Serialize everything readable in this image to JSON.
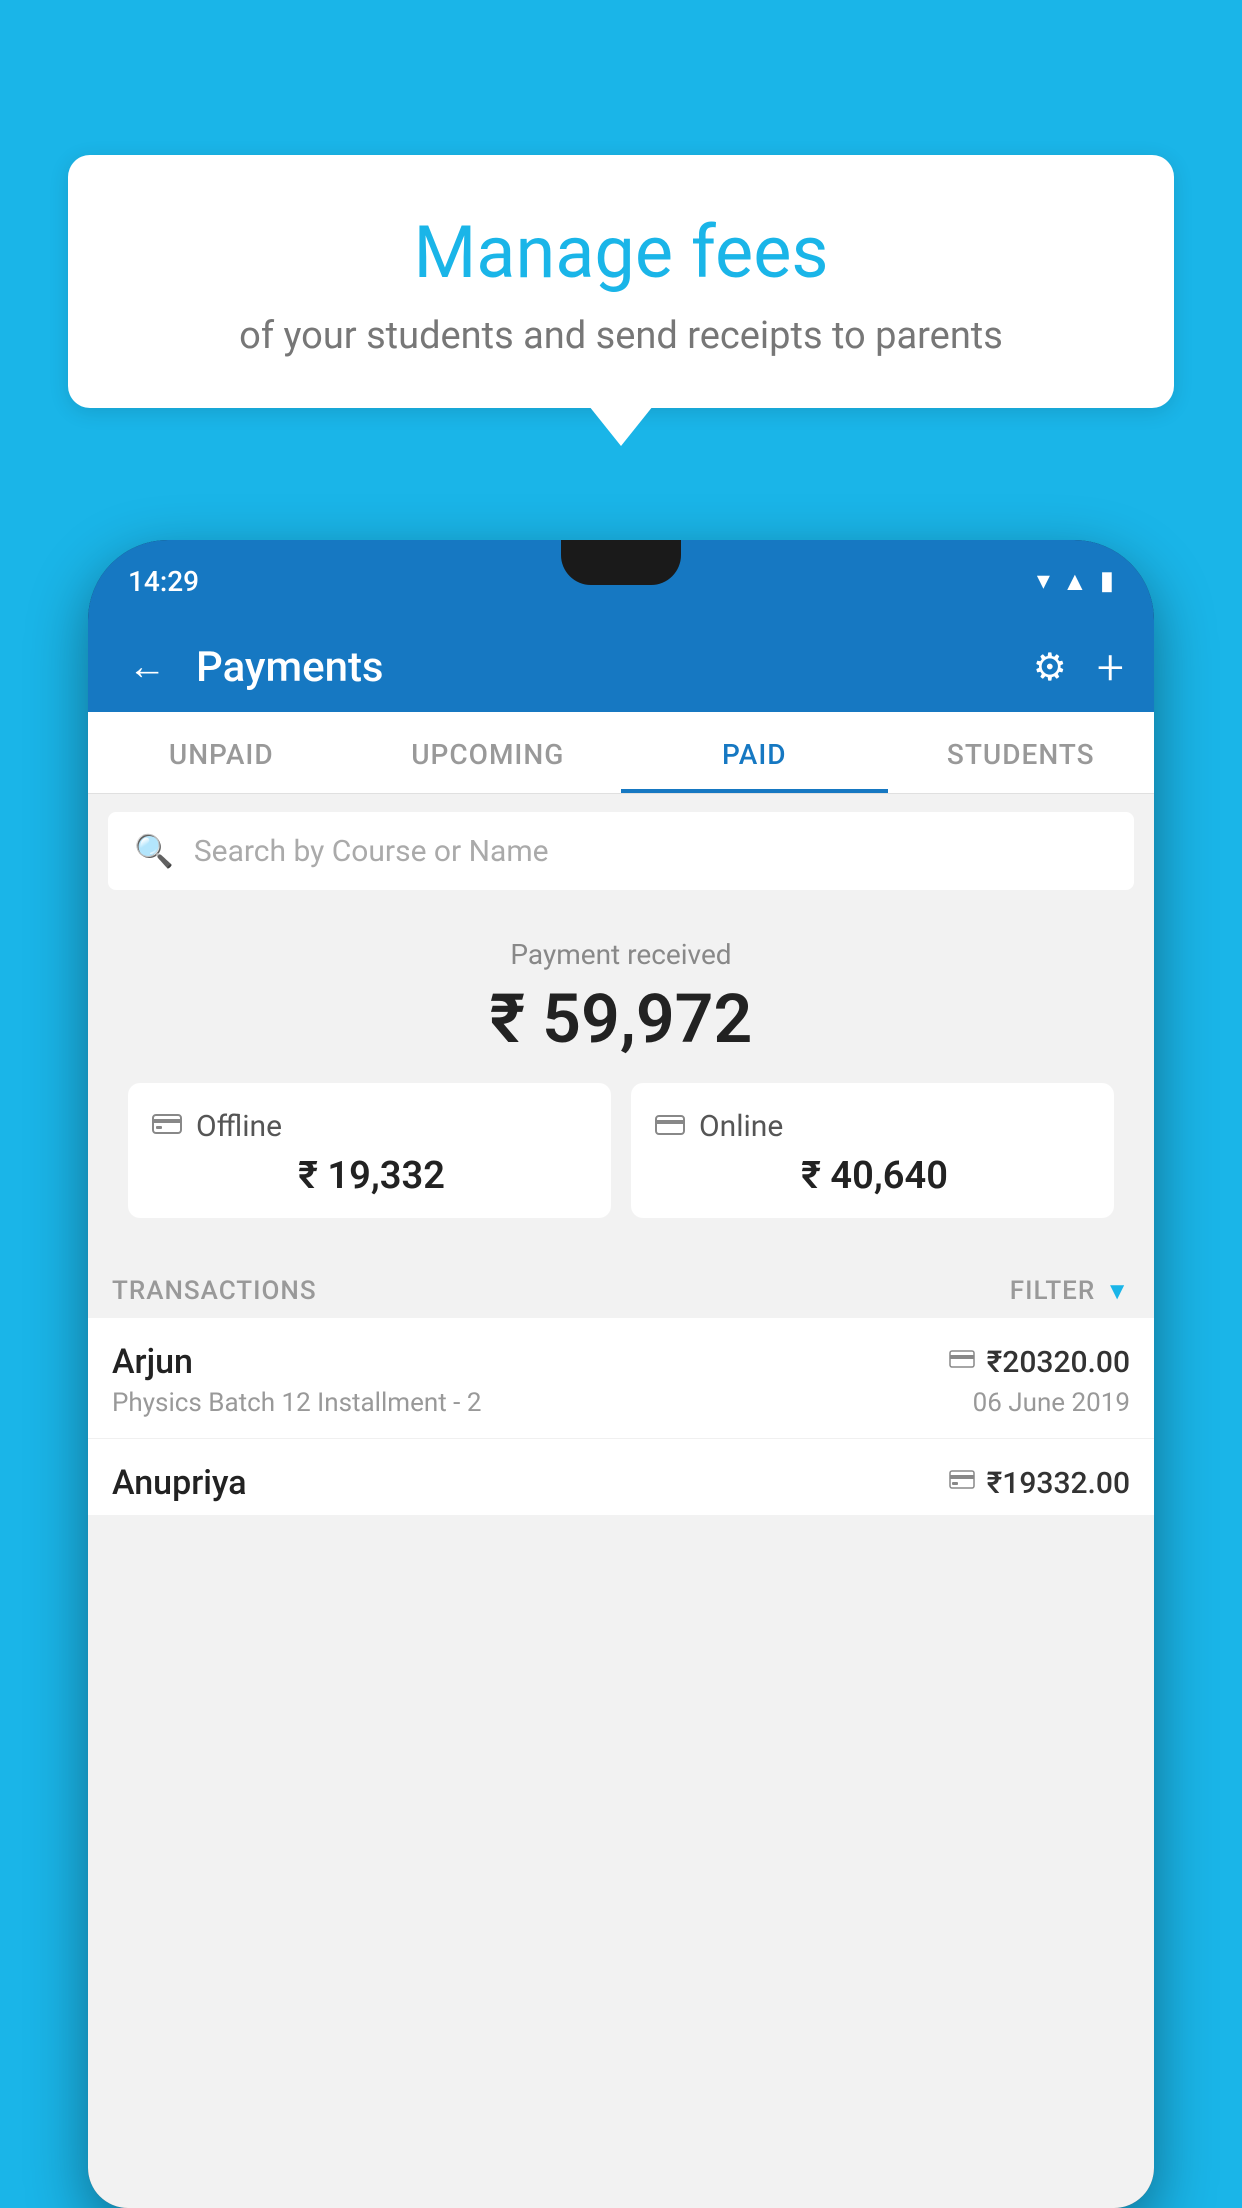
{
  "background_color": "#1ab5e8",
  "tooltip": {
    "title": "Manage fees",
    "subtitle": "of your students and send receipts to parents"
  },
  "phone": {
    "status_time": "14:29",
    "header": {
      "title": "Payments",
      "back_label": "←",
      "settings_icon": "⚙",
      "add_icon": "+"
    },
    "tabs": [
      {
        "label": "UNPAID",
        "active": false
      },
      {
        "label": "UPCOMING",
        "active": false
      },
      {
        "label": "PAID",
        "active": true
      },
      {
        "label": "STUDENTS",
        "active": false
      }
    ],
    "search": {
      "placeholder": "Search by Course or Name"
    },
    "payment_summary": {
      "label": "Payment received",
      "amount": "₹ 59,972",
      "offline": {
        "icon": "💳",
        "label": "Offline",
        "amount": "₹ 19,332"
      },
      "online": {
        "icon": "💳",
        "label": "Online",
        "amount": "₹ 40,640"
      }
    },
    "transactions": {
      "header_label": "TRANSACTIONS",
      "filter_label": "FILTER",
      "items": [
        {
          "name": "Arjun",
          "description": "Physics Batch 12 Installment - 2",
          "amount": "₹20320.00",
          "date": "06 June 2019",
          "payment_type": "online"
        },
        {
          "name": "Anupriya",
          "description": "",
          "amount": "₹19332.00",
          "date": "",
          "payment_type": "offline"
        }
      ]
    }
  }
}
